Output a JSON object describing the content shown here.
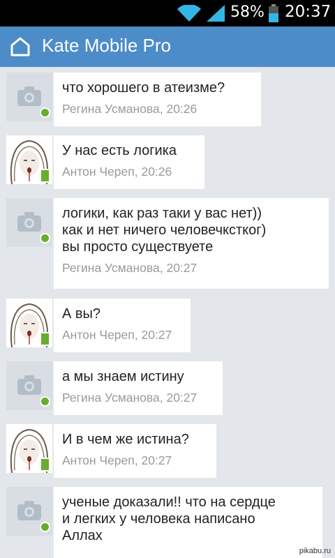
{
  "status_bar": {
    "battery": "58%",
    "time": "20:37"
  },
  "app_bar": {
    "title": "Kate Mobile Pro"
  },
  "messages": [
    {
      "text": "что хорошего в атеизме?",
      "meta": "Регина Усманова, 20:26"
    },
    {
      "text": "У нас есть логика",
      "meta": "Антон Череп, 20:26"
    },
    {
      "text": "логики, как раз таки у вас нет))\nкак и нет ничего человечкстког)\nвы просто существуете",
      "meta": "Регина Усманова, 20:27"
    },
    {
      "text": "А вы?",
      "meta": "Антон Череп, 20:27"
    },
    {
      "text": "а мы знаем истину",
      "meta": "Регина Усманова, 20:27"
    },
    {
      "text": "И в чем же истина?",
      "meta": "Антон Череп, 20:27"
    },
    {
      "text": "ученые доказали!! что на сердце\nи легких у человека написано\nАллах",
      "meta": ""
    }
  ],
  "watermark": "pikabu.ru",
  "colors": {
    "app_bar": "#4c8cc9",
    "background": "#e3e6ea",
    "online": "#67ad2f"
  }
}
